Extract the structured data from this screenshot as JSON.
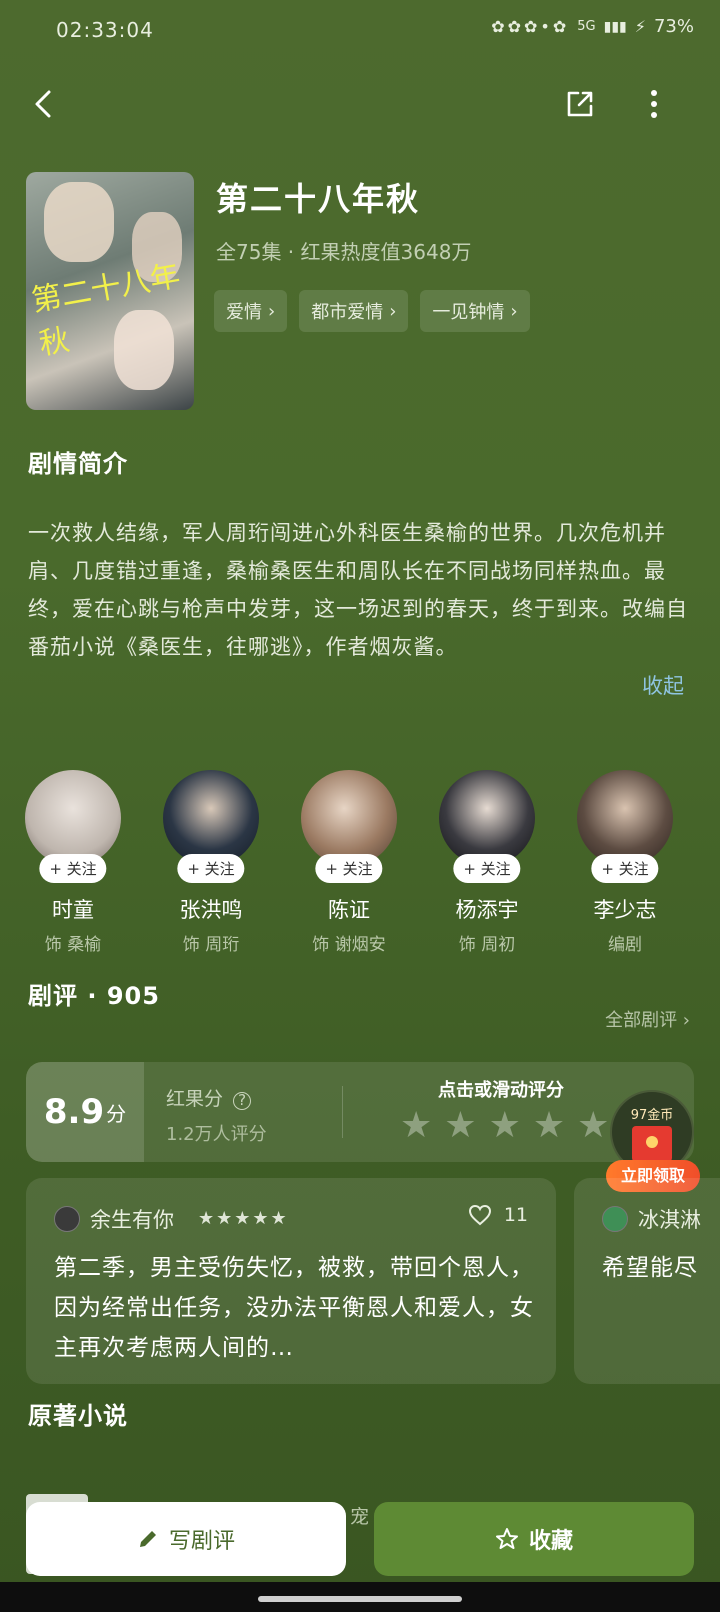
{
  "status_bar": {
    "time": "02:33:04",
    "network": "5G",
    "battery": "73%",
    "icons": [
      "notification-icons",
      "signal-icon",
      "battery-icon"
    ]
  },
  "navbar": {
    "back_icon": "back-arrow-icon",
    "share_icon": "share-icon",
    "more_icon": "more-vertical-icon"
  },
  "drama": {
    "title": "第二十八年秋",
    "meta": "全75集 · 红果热度值3648万",
    "poster_text": "第二十八年秋",
    "tags": [
      "爱情",
      "都市爱情",
      "一见钟情"
    ]
  },
  "synopsis": {
    "heading": "剧情简介",
    "text": "一次救人结缘，军人周珩闯进心外科医生桑榆的世界。几次危机并肩、几度错过重逢，桑榆桑医生和周队长在不同战场同样热血。最终，爱在心跳与枪声中发芽，这一场迟到的春天，终于到来。改编自番茄小说《桑医生，往哪逃》，作者烟灰酱。",
    "collapse_label": "收起"
  },
  "cast": [
    {
      "name": "时童",
      "role": "饰 桑榆",
      "follow": "+ 关注",
      "color": "#d9d2cc"
    },
    {
      "name": "张洪鸣",
      "role": "饰 周珩",
      "follow": "+ 关注",
      "color": "#1e2a3a"
    },
    {
      "name": "陈证",
      "role": "饰 谢烟安",
      "follow": "+ 关注",
      "color": "#8c6a52"
    },
    {
      "name": "杨添宇",
      "role": "饰 周初",
      "follow": "+ 关注",
      "color": "#1a1a1e"
    },
    {
      "name": "李少志",
      "role": "编剧",
      "follow": "+ 关注",
      "color": "#3a2e2a"
    }
  ],
  "reviews": {
    "heading": "剧评 · 905",
    "all_label": "全部剧评 ›",
    "score": "8.9",
    "score_unit": "分",
    "score_label": "红果分",
    "score_count": "1.2万人评分",
    "rate_tip": "点击或滑动评分",
    "rate_stars": [
      "★",
      "★",
      "★",
      "★",
      "★"
    ],
    "cards": [
      {
        "user": "余生有你",
        "stars": "★★★★★",
        "likes": "11",
        "text": "第二季，男主受伤失忆，被救，带回个恩人，因为经常出任务，没办法平衡恩人和爱人，女主再次考虑两人间的…"
      },
      {
        "user": "冰淇淋",
        "text": "希望能尽"
      }
    ]
  },
  "reward": {
    "coins": "97金币",
    "button": "立即领取"
  },
  "novel": {
    "heading": "原著小说",
    "peek": "宠"
  },
  "bottom_bar": {
    "review_button": "写剧评",
    "collect_button": "收藏"
  }
}
